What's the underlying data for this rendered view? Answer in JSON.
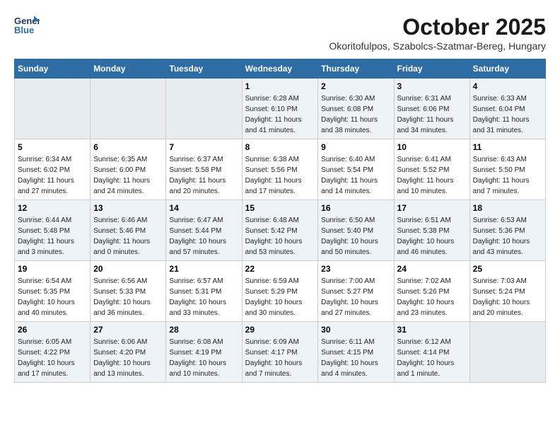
{
  "header": {
    "logo_line1": "General",
    "logo_line2": "Blue",
    "month": "October 2025",
    "location": "Okoritofulpos, Szabolcs-Szatmar-Bereg, Hungary"
  },
  "weekdays": [
    "Sunday",
    "Monday",
    "Tuesday",
    "Wednesday",
    "Thursday",
    "Friday",
    "Saturday"
  ],
  "weeks": [
    [
      {
        "day": "",
        "detail": ""
      },
      {
        "day": "",
        "detail": ""
      },
      {
        "day": "",
        "detail": ""
      },
      {
        "day": "1",
        "detail": "Sunrise: 6:28 AM\nSunset: 6:10 PM\nDaylight: 11 hours\nand 41 minutes."
      },
      {
        "day": "2",
        "detail": "Sunrise: 6:30 AM\nSunset: 6:08 PM\nDaylight: 11 hours\nand 38 minutes."
      },
      {
        "day": "3",
        "detail": "Sunrise: 6:31 AM\nSunset: 6:06 PM\nDaylight: 11 hours\nand 34 minutes."
      },
      {
        "day": "4",
        "detail": "Sunrise: 6:33 AM\nSunset: 6:04 PM\nDaylight: 11 hours\nand 31 minutes."
      }
    ],
    [
      {
        "day": "5",
        "detail": "Sunrise: 6:34 AM\nSunset: 6:02 PM\nDaylight: 11 hours\nand 27 minutes."
      },
      {
        "day": "6",
        "detail": "Sunrise: 6:35 AM\nSunset: 6:00 PM\nDaylight: 11 hours\nand 24 minutes."
      },
      {
        "day": "7",
        "detail": "Sunrise: 6:37 AM\nSunset: 5:58 PM\nDaylight: 11 hours\nand 20 minutes."
      },
      {
        "day": "8",
        "detail": "Sunrise: 6:38 AM\nSunset: 5:56 PM\nDaylight: 11 hours\nand 17 minutes."
      },
      {
        "day": "9",
        "detail": "Sunrise: 6:40 AM\nSunset: 5:54 PM\nDaylight: 11 hours\nand 14 minutes."
      },
      {
        "day": "10",
        "detail": "Sunrise: 6:41 AM\nSunset: 5:52 PM\nDaylight: 11 hours\nand 10 minutes."
      },
      {
        "day": "11",
        "detail": "Sunrise: 6:43 AM\nSunset: 5:50 PM\nDaylight: 11 hours\nand 7 minutes."
      }
    ],
    [
      {
        "day": "12",
        "detail": "Sunrise: 6:44 AM\nSunset: 5:48 PM\nDaylight: 11 hours\nand 3 minutes."
      },
      {
        "day": "13",
        "detail": "Sunrise: 6:46 AM\nSunset: 5:46 PM\nDaylight: 11 hours\nand 0 minutes."
      },
      {
        "day": "14",
        "detail": "Sunrise: 6:47 AM\nSunset: 5:44 PM\nDaylight: 10 hours\nand 57 minutes."
      },
      {
        "day": "15",
        "detail": "Sunrise: 6:48 AM\nSunset: 5:42 PM\nDaylight: 10 hours\nand 53 minutes."
      },
      {
        "day": "16",
        "detail": "Sunrise: 6:50 AM\nSunset: 5:40 PM\nDaylight: 10 hours\nand 50 minutes."
      },
      {
        "day": "17",
        "detail": "Sunrise: 6:51 AM\nSunset: 5:38 PM\nDaylight: 10 hours\nand 46 minutes."
      },
      {
        "day": "18",
        "detail": "Sunrise: 6:53 AM\nSunset: 5:36 PM\nDaylight: 10 hours\nand 43 minutes."
      }
    ],
    [
      {
        "day": "19",
        "detail": "Sunrise: 6:54 AM\nSunset: 5:35 PM\nDaylight: 10 hours\nand 40 minutes."
      },
      {
        "day": "20",
        "detail": "Sunrise: 6:56 AM\nSunset: 5:33 PM\nDaylight: 10 hours\nand 36 minutes."
      },
      {
        "day": "21",
        "detail": "Sunrise: 6:57 AM\nSunset: 5:31 PM\nDaylight: 10 hours\nand 33 minutes."
      },
      {
        "day": "22",
        "detail": "Sunrise: 6:59 AM\nSunset: 5:29 PM\nDaylight: 10 hours\nand 30 minutes."
      },
      {
        "day": "23",
        "detail": "Sunrise: 7:00 AM\nSunset: 5:27 PM\nDaylight: 10 hours\nand 27 minutes."
      },
      {
        "day": "24",
        "detail": "Sunrise: 7:02 AM\nSunset: 5:26 PM\nDaylight: 10 hours\nand 23 minutes."
      },
      {
        "day": "25",
        "detail": "Sunrise: 7:03 AM\nSunset: 5:24 PM\nDaylight: 10 hours\nand 20 minutes."
      }
    ],
    [
      {
        "day": "26",
        "detail": "Sunrise: 6:05 AM\nSunset: 4:22 PM\nDaylight: 10 hours\nand 17 minutes."
      },
      {
        "day": "27",
        "detail": "Sunrise: 6:06 AM\nSunset: 4:20 PM\nDaylight: 10 hours\nand 13 minutes."
      },
      {
        "day": "28",
        "detail": "Sunrise: 6:08 AM\nSunset: 4:19 PM\nDaylight: 10 hours\nand 10 minutes."
      },
      {
        "day": "29",
        "detail": "Sunrise: 6:09 AM\nSunset: 4:17 PM\nDaylight: 10 hours\nand 7 minutes."
      },
      {
        "day": "30",
        "detail": "Sunrise: 6:11 AM\nSunset: 4:15 PM\nDaylight: 10 hours\nand 4 minutes."
      },
      {
        "day": "31",
        "detail": "Sunrise: 6:12 AM\nSunset: 4:14 PM\nDaylight: 10 hours\nand 1 minute."
      },
      {
        "day": "",
        "detail": ""
      }
    ]
  ]
}
